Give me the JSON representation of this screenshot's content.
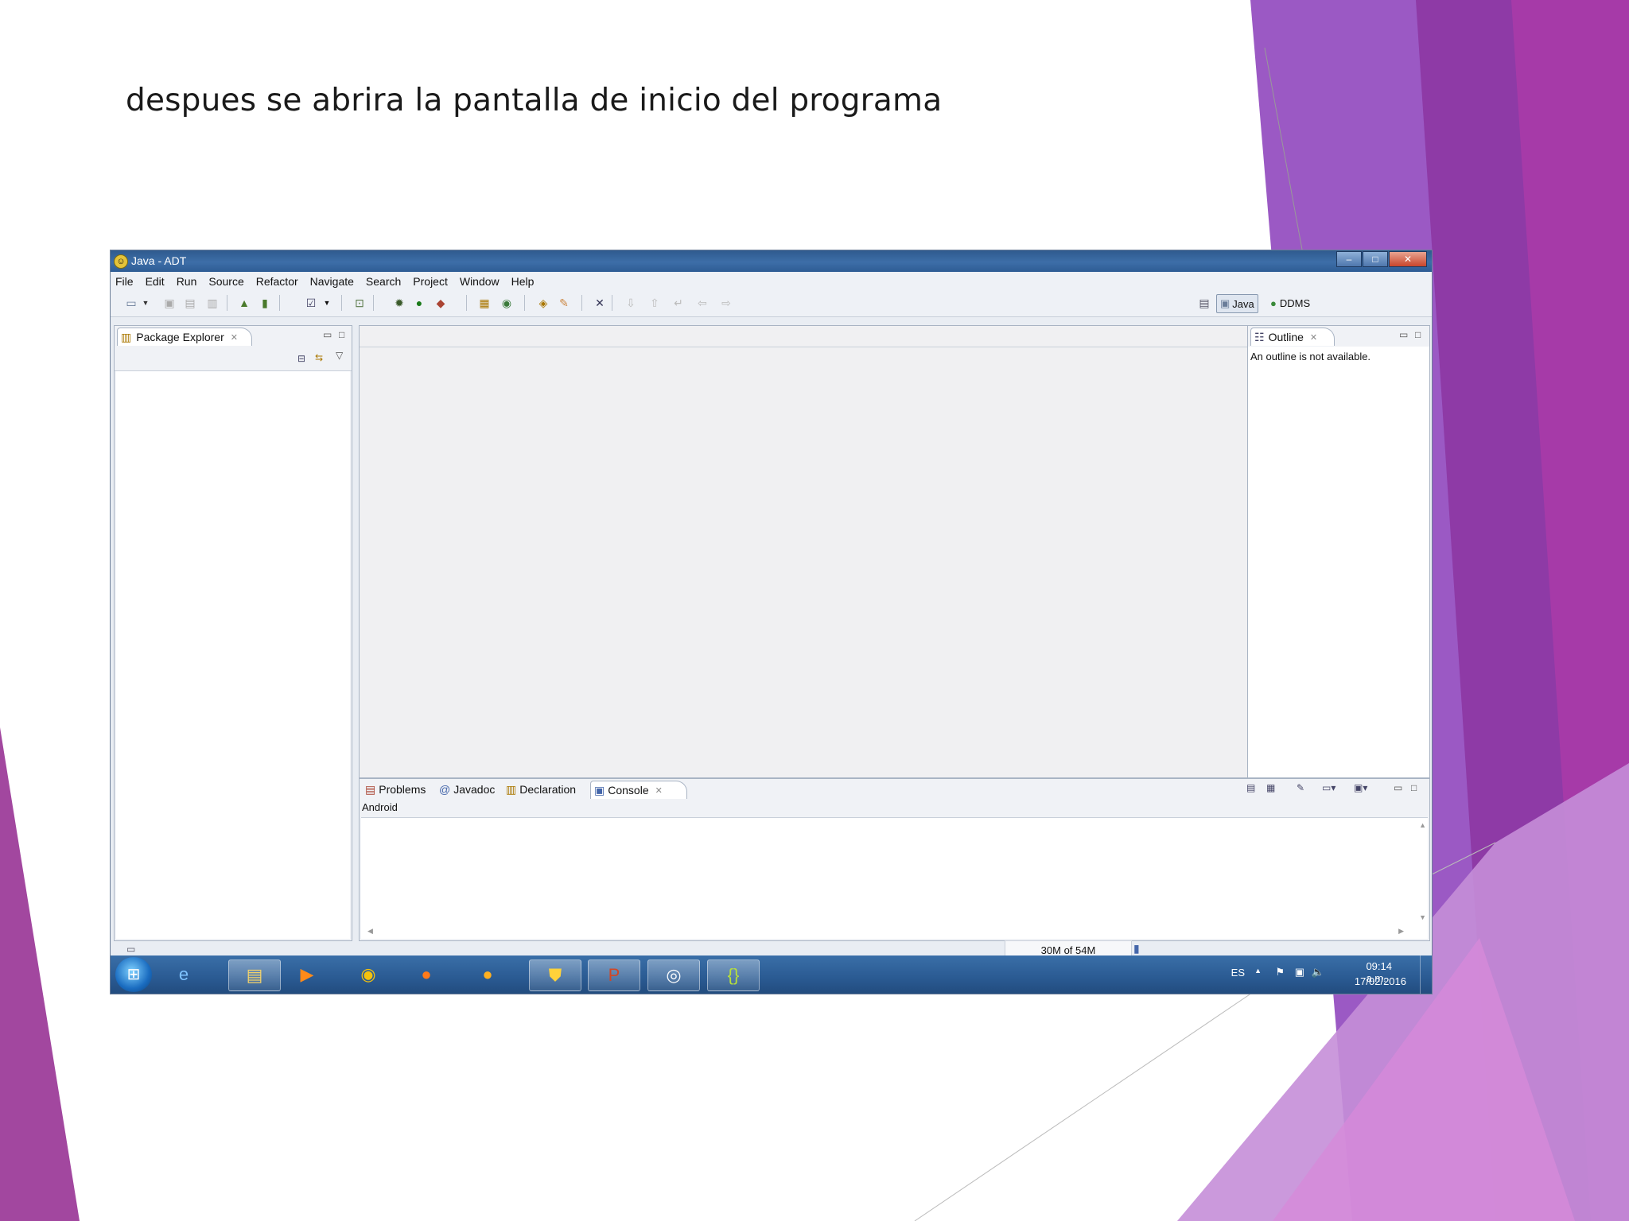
{
  "slide": {
    "caption": "despues se abrira la pantalla de inicio del programa",
    "colors": {
      "purple_dark": "#8e2f9a",
      "purple_mid": "#a35bd0",
      "purple_light": "#c891e0"
    }
  },
  "window": {
    "title": "Java - ADT",
    "menu": [
      "File",
      "Edit",
      "Run",
      "Source",
      "Refactor",
      "Navigate",
      "Search",
      "Project",
      "Window",
      "Help"
    ],
    "perspectives": {
      "java": "Java",
      "ddms": "DDMS"
    },
    "package_explorer": {
      "tab": "Package Explorer"
    },
    "outline": {
      "tab": "Outline",
      "message": "An outline is not available."
    },
    "bottom_tabs": [
      "Problems",
      "Javadoc",
      "Declaration",
      "Console"
    ],
    "console": {
      "name": "Android"
    },
    "status": {
      "memory": "30M of 54M"
    }
  },
  "taskbar": {
    "language": "ES",
    "time": "09:14 a.m.",
    "date": "17/02/2016"
  }
}
